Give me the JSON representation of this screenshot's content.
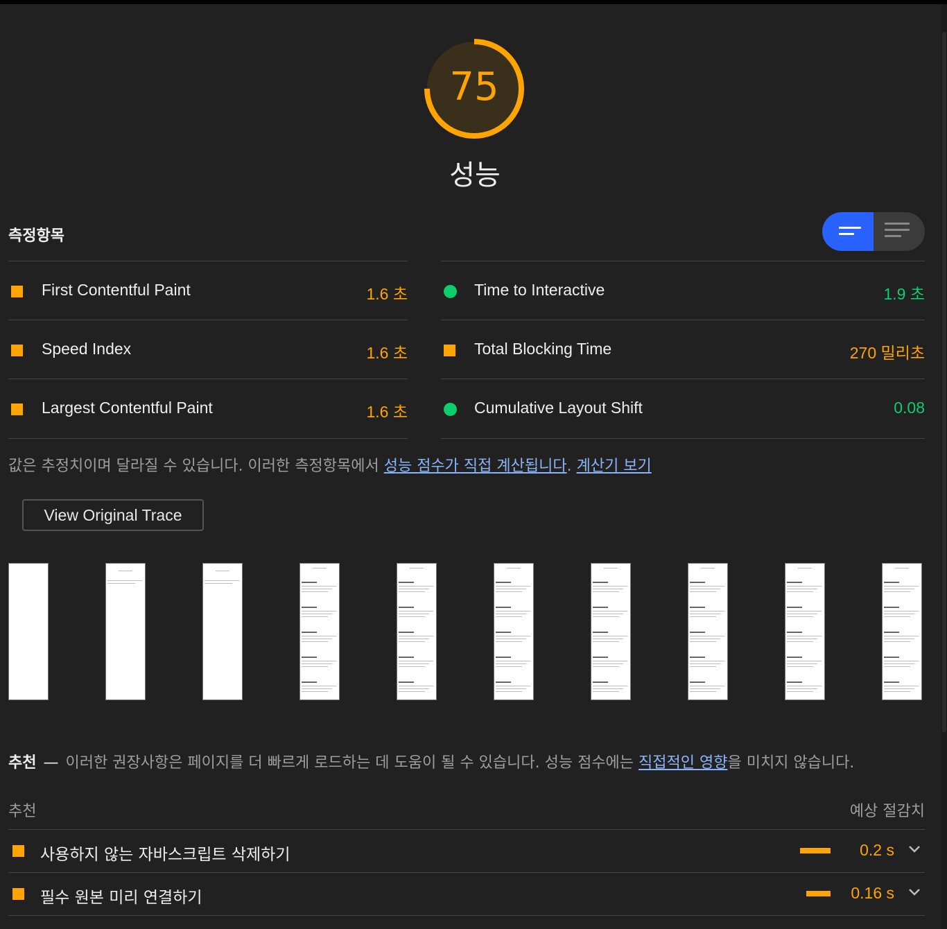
{
  "gauge": {
    "score": "75",
    "score_fraction": 0.75,
    "title": "성능",
    "color": "#ffa400"
  },
  "metrics": {
    "title": "측정항목",
    "left": [
      {
        "label": "First Contentful Paint",
        "value": "1.6 초",
        "status": "average"
      },
      {
        "label": "Speed Index",
        "value": "1.6 초",
        "status": "average"
      },
      {
        "label": "Largest Contentful Paint",
        "value": "1.6 초",
        "status": "average"
      }
    ],
    "right": [
      {
        "label": "Time to Interactive",
        "value": "1.9 초",
        "status": "pass"
      },
      {
        "label": "Total Blocking Time",
        "value": "270 밀리초",
        "status": "average"
      },
      {
        "label": "Cumulative Layout Shift",
        "value": "0.08",
        "status": "pass"
      }
    ],
    "note_prefix": "값은 추정치이며 달라질 수 있습니다. 이러한 측정항목에서 ",
    "note_link1": "성능 점수가 직접 계산됩니다",
    "note_sep": ". ",
    "note_link2": "계산기 보기"
  },
  "trace_button": "View Original Trace",
  "filmstrip": {
    "frame_count": 10
  },
  "opportunities": {
    "heading": "추천",
    "dash": "—",
    "desc_prefix": "이러한 권장사항은 페이지를 더 빠르게 로드하는 데 도움이 될 수 있습니다. 성능 점수에는 ",
    "desc_link": "직접적인 영향",
    "desc_suffix": "을 미치지 않습니다.",
    "col_left": "추천",
    "col_right": "예상 절감치",
    "items": [
      {
        "label": "사용하지 않는 자바스크립트 삭제하기",
        "value": "0.2 s",
        "savings_fraction": 1.0
      },
      {
        "label": "필수 원본 미리 연결하기",
        "value": "0.16 s",
        "savings_fraction": 0.8
      }
    ]
  },
  "colors": {
    "average": "#ffa400",
    "pass": "#0cce6b",
    "link": "#8ab4f8",
    "toggle_active": "#2962ff"
  }
}
